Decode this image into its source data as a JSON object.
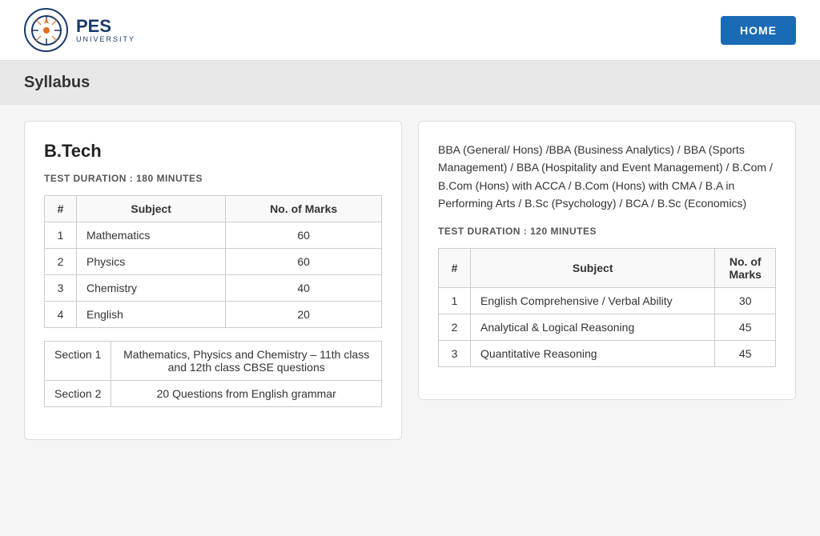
{
  "header": {
    "logo_text": "PES",
    "logo_sub": "UNIVERSITY",
    "home_button": "HOME"
  },
  "syllabus_bar": {
    "title": "Syllabus"
  },
  "btech_card": {
    "title": "B.Tech",
    "test_duration": "TEST DURATION : 180 MINUTES",
    "subjects_table": {
      "headers": [
        "#",
        "Subject",
        "No. of Marks"
      ],
      "rows": [
        {
          "num": "1",
          "subject": "Mathematics",
          "marks": "60"
        },
        {
          "num": "2",
          "subject": "Physics",
          "marks": "60"
        },
        {
          "num": "3",
          "subject": "Chemistry",
          "marks": "40"
        },
        {
          "num": "4",
          "subject": "English",
          "marks": "20"
        }
      ]
    },
    "sections_table": {
      "rows": [
        {
          "section": "Section 1",
          "desc": "Mathematics, Physics and Chemistry – 11th class and 12th class CBSE questions"
        },
        {
          "section": "Section 2",
          "desc": "20 Questions from English grammar"
        }
      ]
    }
  },
  "other_card": {
    "program_desc": "BBA (General/ Hons) /BBA (Business Analytics) / BBA (Sports Management) / BBA (Hospitality and Event Management) / B.Com / B.Com (Hons) with ACCA / B.Com (Hons) with CMA / B.A in Performing Arts / B.Sc (Psychology) / BCA / B.Sc (Economics)",
    "test_duration": "TEST DURATION : 120 MINUTES",
    "subjects_table": {
      "headers": [
        "#",
        "Subject",
        "No. of Marks"
      ],
      "rows": [
        {
          "num": "1",
          "subject": "English Comprehensive / Verbal Ability",
          "marks": "30"
        },
        {
          "num": "2",
          "subject": "Analytical & Logical Reasoning",
          "marks": "45"
        },
        {
          "num": "3",
          "subject": "Quantitative Reasoning",
          "marks": "45"
        }
      ]
    }
  }
}
